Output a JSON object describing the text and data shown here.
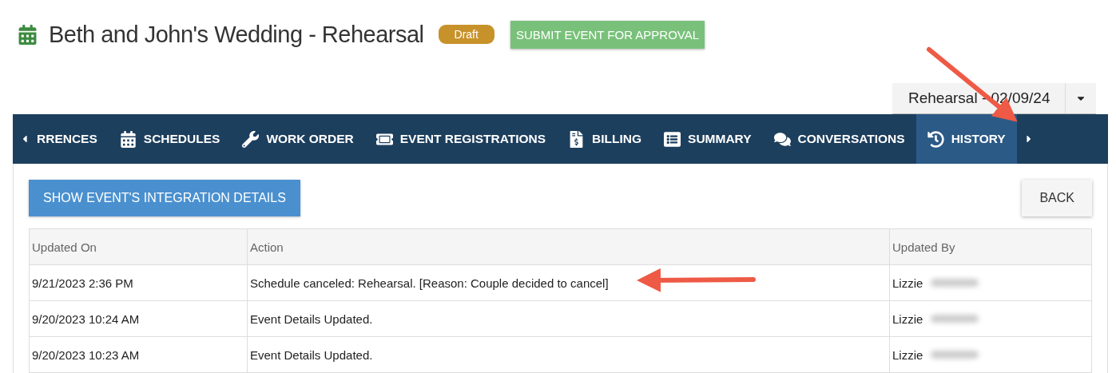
{
  "header": {
    "title": "Beth and John's Wedding - Rehearsal",
    "status_badge": "Draft",
    "submit_button": "SUBMIT EVENT FOR APPROVAL"
  },
  "schedule_select": {
    "value": "Rehearsal - 02/09/24"
  },
  "tabs": [
    {
      "label": "RRENCES",
      "selected": false
    },
    {
      "label": "SCHEDULES",
      "selected": false
    },
    {
      "label": "WORK ORDER",
      "selected": false
    },
    {
      "label": "EVENT REGISTRATIONS",
      "selected": false
    },
    {
      "label": "BILLING",
      "selected": false
    },
    {
      "label": "SUMMARY",
      "selected": false
    },
    {
      "label": "CONVERSATIONS",
      "selected": false
    },
    {
      "label": "HISTORY",
      "selected": true
    }
  ],
  "toolbar": {
    "integration_button": "SHOW EVENT'S INTEGRATION DETAILS",
    "back_button": "BACK"
  },
  "table": {
    "columns": [
      "Updated On",
      "Action",
      "Updated By"
    ],
    "rows": [
      {
        "updated_on": "9/21/2023 2:36 PM",
        "action": "Schedule canceled: Rehearsal. [Reason: Couple decided to cancel]",
        "updated_by": "Lizzie"
      },
      {
        "updated_on": "9/20/2023 10:24 AM",
        "action": "Event Details Updated.",
        "updated_by": "Lizzie"
      },
      {
        "updated_on": "9/20/2023 10:23 AM",
        "action": "Event Details Updated.",
        "updated_by": "Lizzie"
      }
    ]
  }
}
